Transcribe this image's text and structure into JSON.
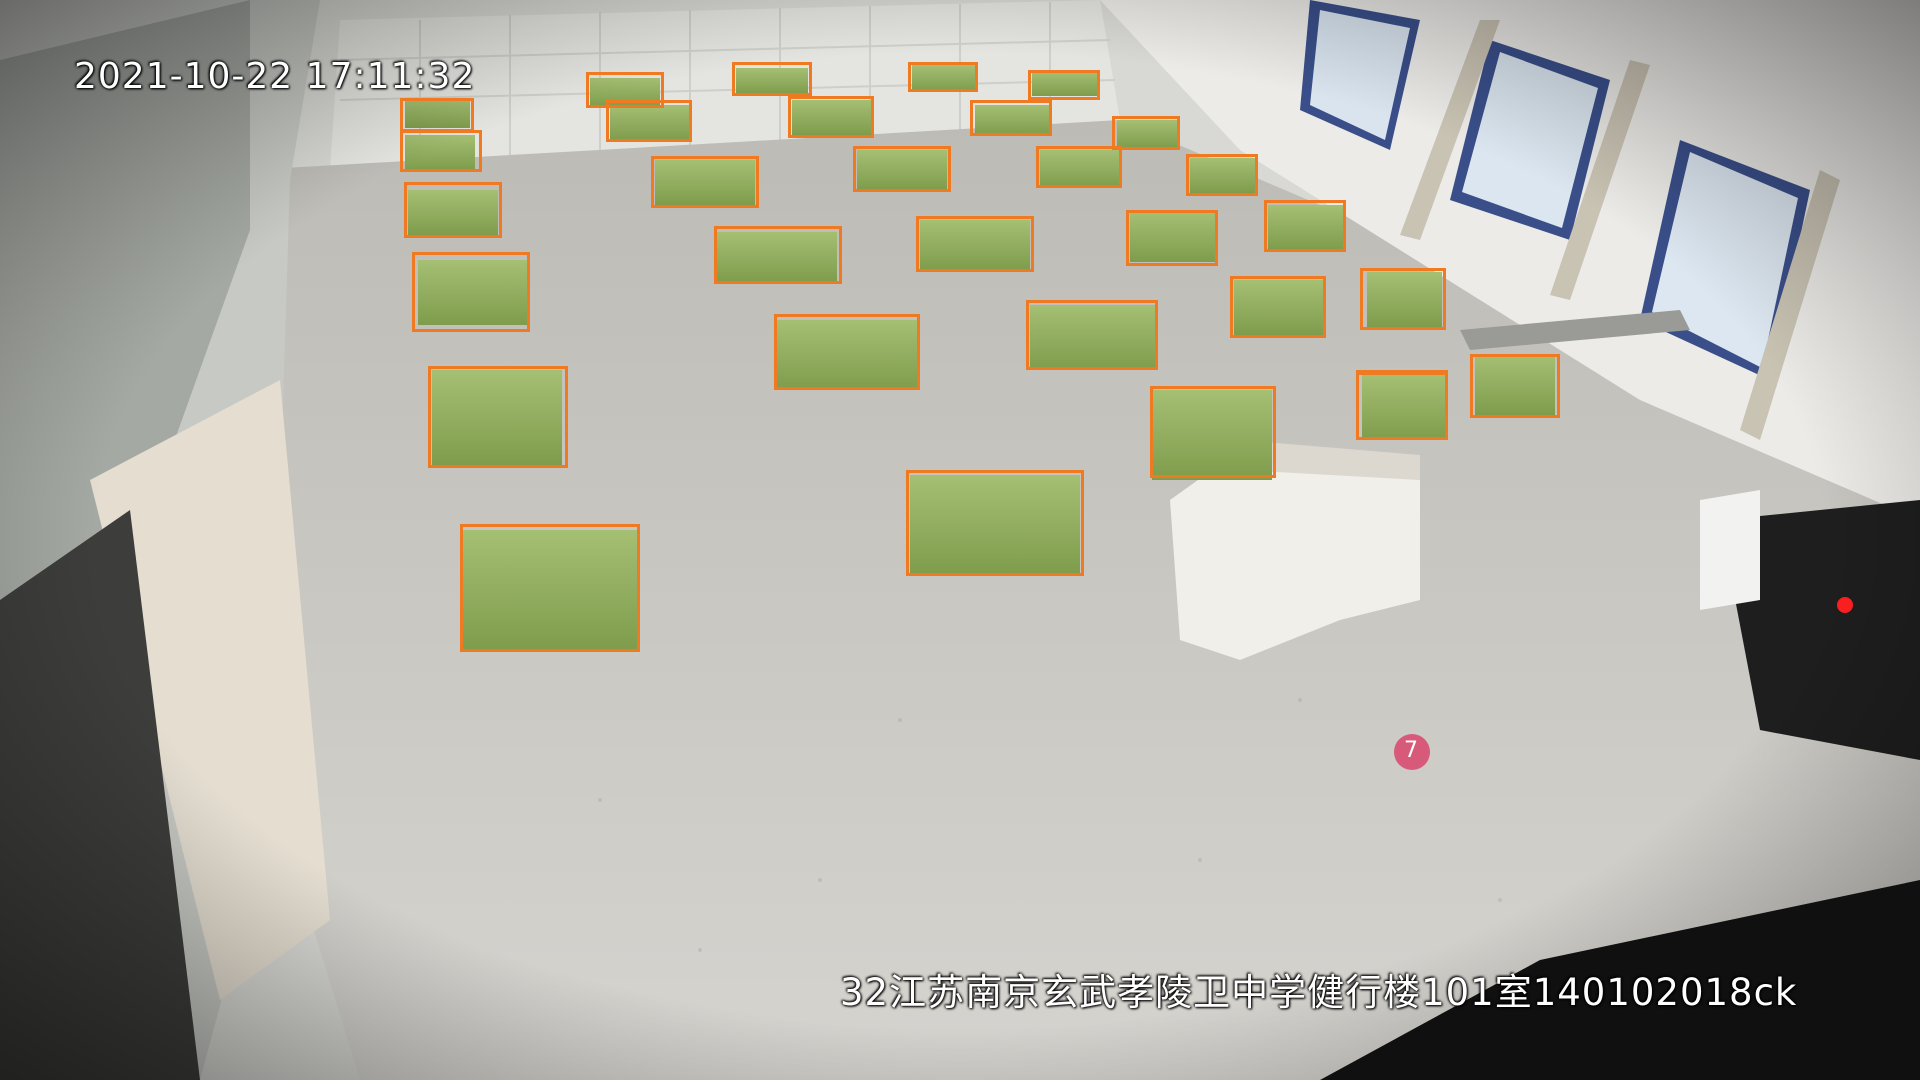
{
  "overlay": {
    "timestamp": "2021-10-22 17:11:32",
    "camera_label": "32江苏南京玄武孝陵卫中学健行楼101室140102018ck"
  },
  "floor_marker": "7",
  "colors": {
    "detection_box": "#f07a22",
    "desk": "#8fae5a",
    "floor": "#c9c7c1",
    "wall": "#e6e6e3"
  },
  "detections": {
    "label": "desk",
    "count": 31
  }
}
